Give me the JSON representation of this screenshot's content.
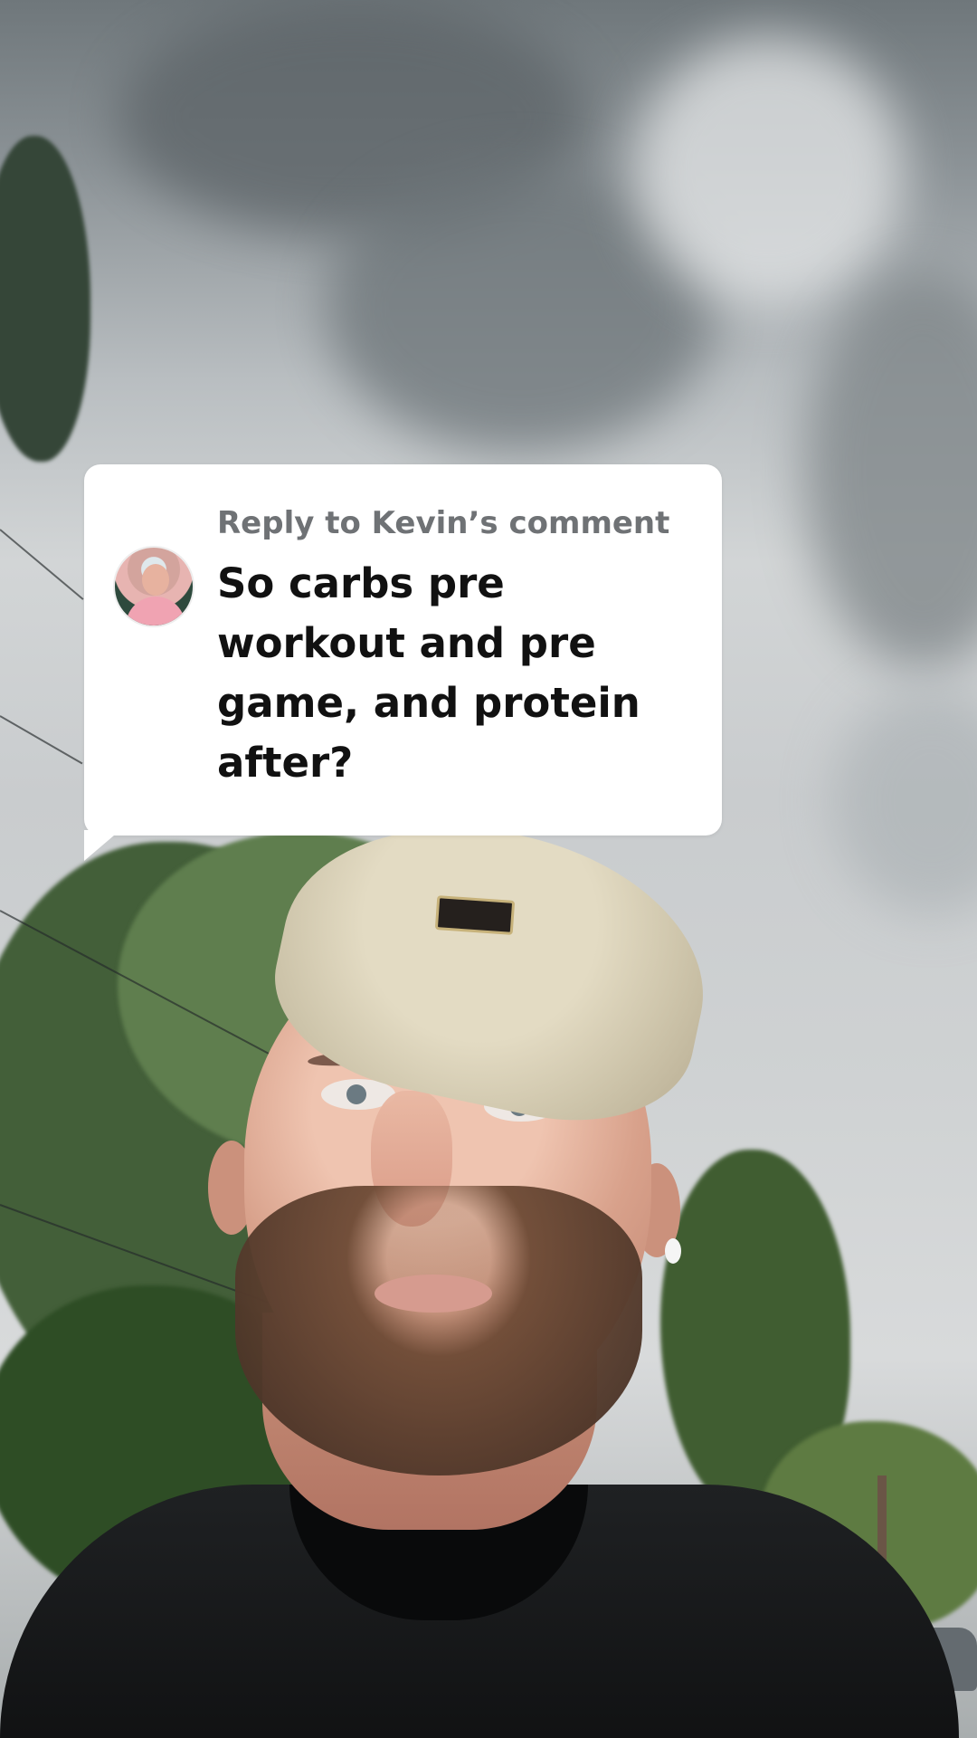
{
  "comment_reply": {
    "label": "Reply to Kevin’s comment",
    "text": "So carbs pre\nworkout and pre\ngame, and protein\nafter?"
  }
}
